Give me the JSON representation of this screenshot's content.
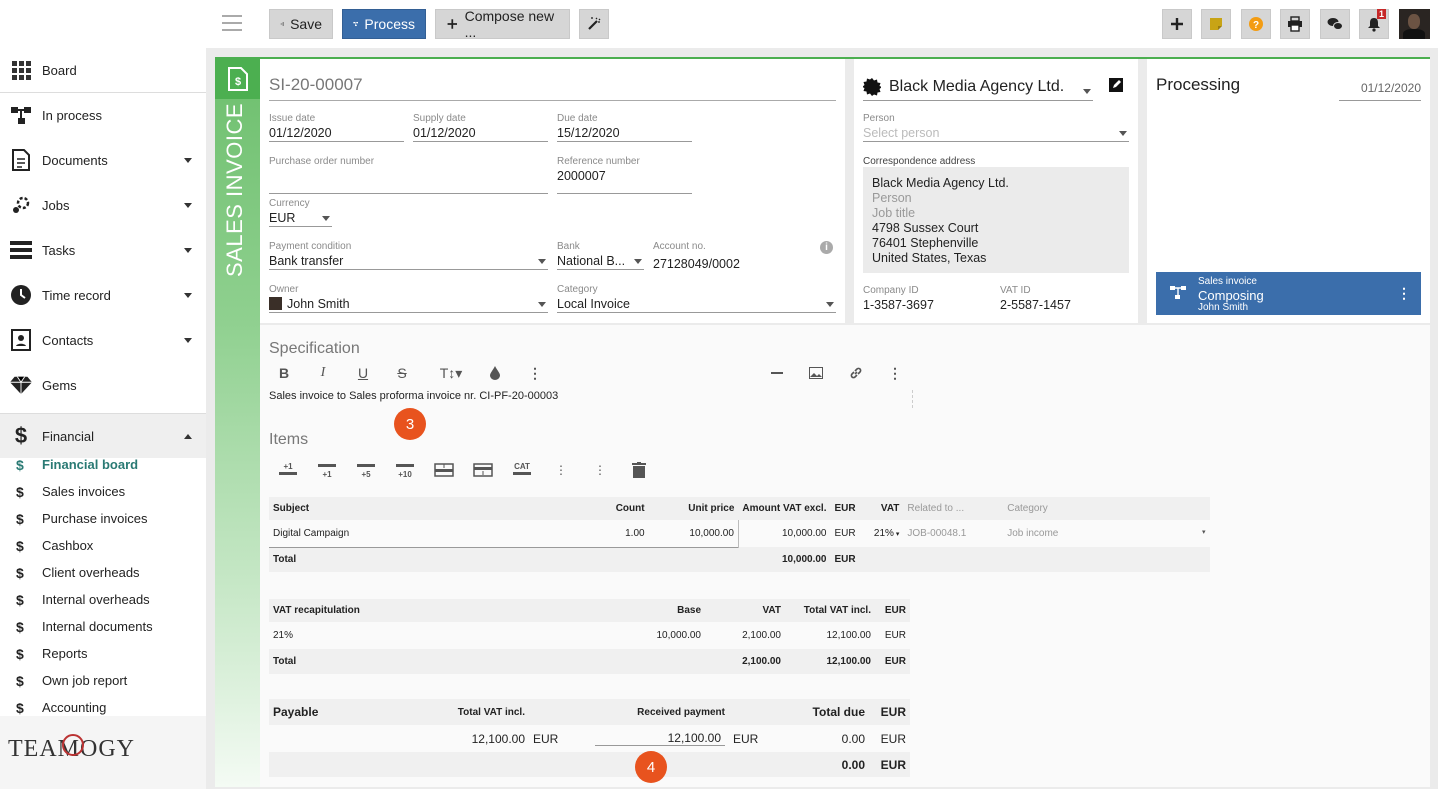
{
  "toolbar": {
    "save_label": "Save",
    "process_label": "Process",
    "compose_label": "Compose new ...",
    "notification_count": "1"
  },
  "sidebar": {
    "items": [
      {
        "label": "Board",
        "icon": "grid-icon"
      },
      {
        "label": "In process",
        "icon": "process-icon"
      },
      {
        "label": "Documents",
        "icon": "document-icon"
      },
      {
        "label": "Jobs",
        "icon": "jobs-icon"
      },
      {
        "label": "Tasks",
        "icon": "tasks-icon"
      },
      {
        "label": "Time record",
        "icon": "clock-icon"
      },
      {
        "label": "Contacts",
        "icon": "contacts-icon"
      },
      {
        "label": "Gems",
        "icon": "gem-icon"
      },
      {
        "label": "Financial",
        "icon": "dollar-icon"
      }
    ],
    "financial_items": [
      "Financial board",
      "Sales invoices",
      "Purchase invoices",
      "Cashbox",
      "Client overheads",
      "Internal overheads",
      "Internal documents",
      "Reports",
      "Own job report",
      "Accounting"
    ],
    "logo": "TEAMOGY"
  },
  "doc": {
    "type_label": "SALES INVOICE",
    "number": "SI-20-00007",
    "issue_date_label": "Issue date",
    "issue_date": "01/12/2020",
    "supply_date_label": "Supply date",
    "supply_date": "01/12/2020",
    "due_date_label": "Due date",
    "due_date": "15/12/2020",
    "po_label": "Purchase order number",
    "po_value": "",
    "ref_label": "Reference number",
    "ref_value": "2000007",
    "currency_label": "Currency",
    "currency": "EUR",
    "payment_label": "Payment condition",
    "payment": "Bank transfer",
    "bank_label": "Bank",
    "bank": "National B...",
    "account_label": "Account no.",
    "account": "27128049/0002",
    "owner_label": "Owner",
    "owner": "John Smith",
    "category_label": "Category",
    "category": "Local Invoice"
  },
  "client": {
    "name": "Black Media Agency Ltd.",
    "person_label": "Person",
    "person_placeholder": "Select person",
    "address_label": "Correspondence address",
    "address": {
      "company": "Black Media Agency Ltd.",
      "person": "Person",
      "job_title": "Job title",
      "street": "4798 Sussex Court",
      "city": "76401 Stephenville",
      "country": "United States, Texas"
    },
    "company_id_label": "Company ID",
    "company_id": "1-3587-3697",
    "vat_id_label": "VAT ID",
    "vat_id": "2-5587-1457"
  },
  "processing": {
    "title": "Processing",
    "date": "01/12/2020",
    "workflow": {
      "type": "Sales invoice",
      "state": "Composing",
      "user": "John Smith"
    }
  },
  "specification": {
    "title": "Specification",
    "text": "Sales invoice to Sales proforma invoice nr. CI-PF-20-00003"
  },
  "markers": {
    "m1": "3",
    "m2": "4"
  },
  "items": {
    "title": "Items",
    "toolbar": [
      "+1",
      "+1",
      "+5",
      "+10",
      "CAT"
    ],
    "headers": {
      "subject": "Subject",
      "count": "Count",
      "unit_price": "Unit price",
      "amount": "Amount VAT excl.",
      "cur": "EUR",
      "vat": "VAT",
      "related": "Related to ...",
      "category": "Category"
    },
    "rows": [
      {
        "subject": "Digital Campaign",
        "count": "1.00",
        "unit_price": "10,000.00",
        "amount": "10,000.00",
        "cur": "EUR",
        "vat": "21%",
        "related": "JOB-00048.1",
        "category": "Job income"
      }
    ],
    "total_label": "Total",
    "total_amount": "10,000.00",
    "total_cur": "EUR"
  },
  "vat": {
    "headers": {
      "title": "VAT recapitulation",
      "base": "Base",
      "vat": "VAT",
      "total": "Total VAT incl.",
      "cur": "EUR"
    },
    "rows": [
      {
        "rate": "21%",
        "base": "10,000.00",
        "vat": "2,100.00",
        "total": "12,100.00",
        "cur": "EUR"
      }
    ],
    "total_label": "Total",
    "total_vat": "2,100.00",
    "total_incl": "12,100.00",
    "total_cur": "EUR"
  },
  "payable": {
    "headers": {
      "title": "Payable",
      "total": "Total VAT incl.",
      "received": "Received payment",
      "due": "Total due",
      "cur": "EUR"
    },
    "total": "12,100.00",
    "total_cur": "EUR",
    "received": "12,100.00",
    "received_cur": "EUR",
    "due": "0.00",
    "due_cur": "EUR",
    "final_due": "0.00",
    "final_cur": "EUR"
  }
}
